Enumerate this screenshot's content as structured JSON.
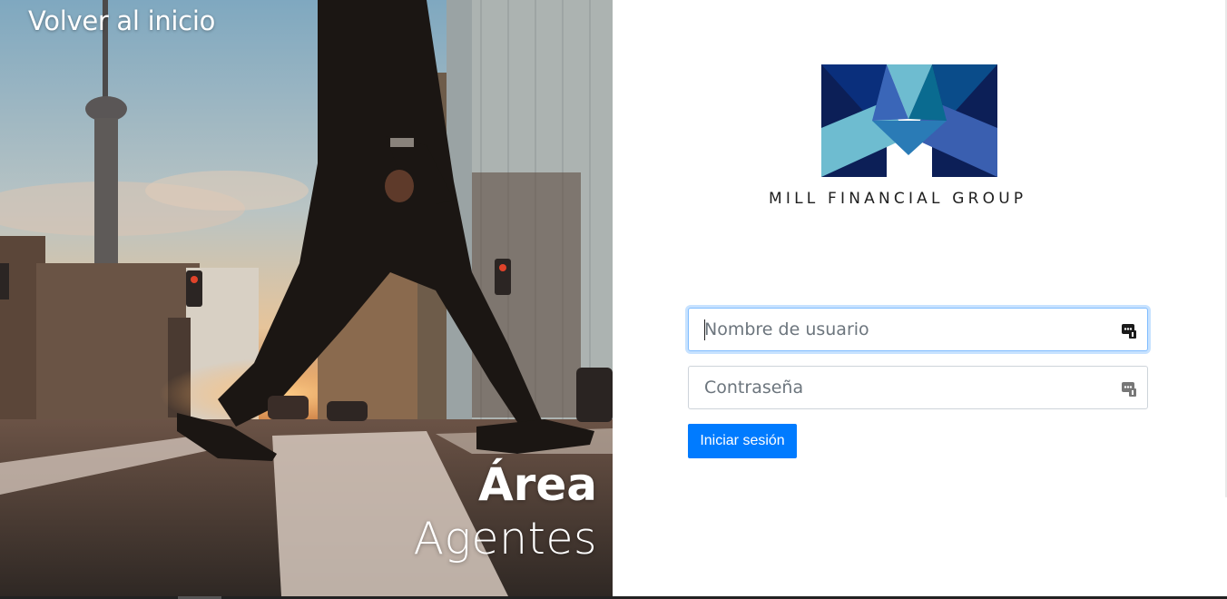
{
  "hero": {
    "back_link": "Volver al inicio",
    "title_line1": "Área",
    "title_line2": "Agentes"
  },
  "brand": {
    "company_name": "MILL FINANCIAL GROUP",
    "logo_colors": [
      "#0a2f7c",
      "#0c1f57",
      "#6ebcd0",
      "#2a7bb6",
      "#3a5fb0"
    ]
  },
  "login": {
    "username_placeholder": "Nombre de usuario",
    "password_placeholder": "Contraseña",
    "submit_label": "Iniciar sesión",
    "field_icon": "keepass-icon"
  },
  "colors": {
    "primary": "#007bff",
    "focus_border": "#80bdff"
  }
}
